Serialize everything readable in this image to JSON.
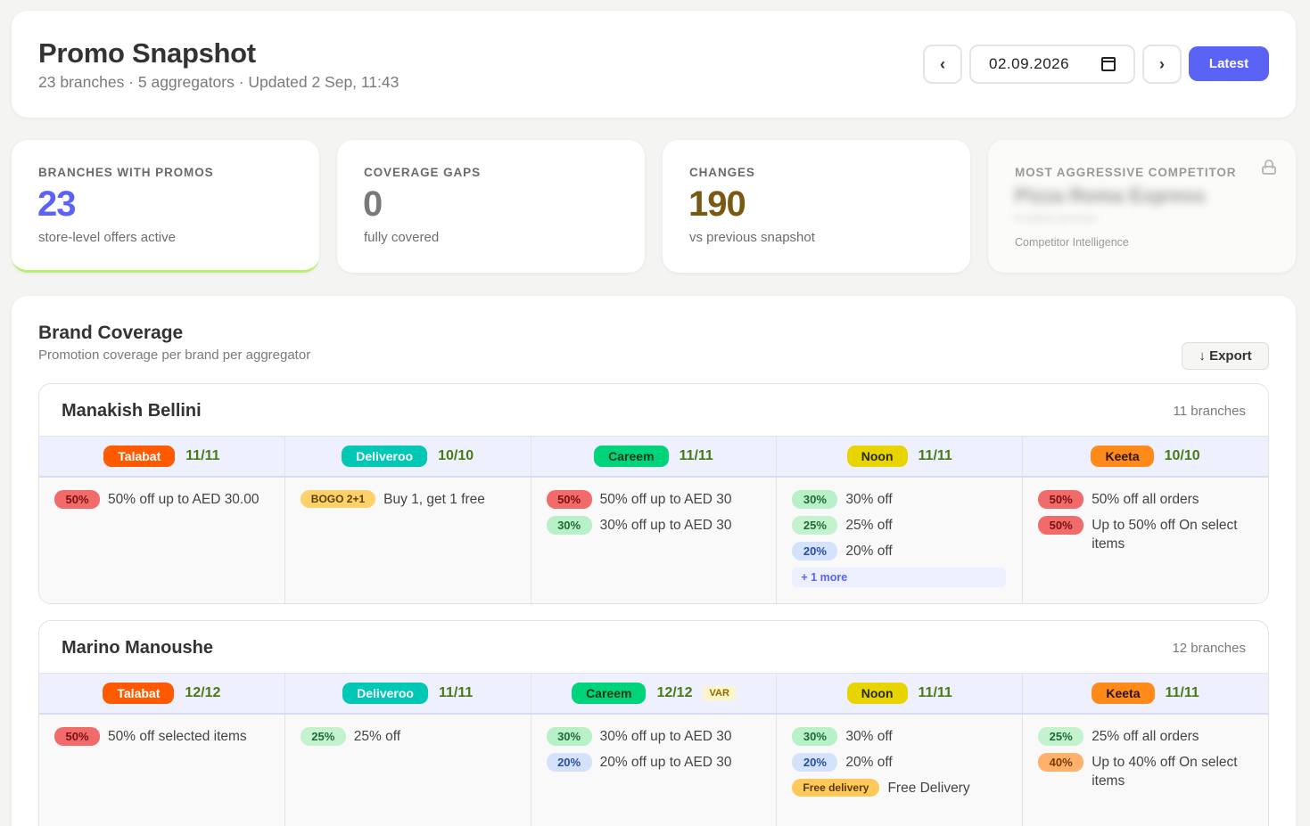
{
  "header": {
    "title": "Promo Snapshot",
    "subtitle": "23 branches · 5 aggregators · Updated 2 Sep, 11:43",
    "prev_label": "‹",
    "next_label": "›",
    "date": "02.09.2026",
    "latest_label": "Latest"
  },
  "stats": [
    {
      "label": "BRANCHES WITH PROMOS",
      "value": "23",
      "desc": "store-level offers active",
      "color": "#5b63f6"
    },
    {
      "label": "COVERAGE GAPS",
      "value": "0",
      "desc": "fully covered",
      "color": "#7a7a7a"
    },
    {
      "label": "CHANGES",
      "value": "190",
      "desc": "vs previous snapshot",
      "color": "#7a5a12"
    },
    {
      "label": "MOST AGGRESSIVE COMPETITOR",
      "blurred_name": "Pizza Roma Express",
      "blurred_sub": "9 active promos",
      "desc": "Competitor Intelligence"
    }
  ],
  "coverage": {
    "title": "Brand Coverage",
    "subtitle": "Promotion coverage per brand per aggregator",
    "export_label": "↓ Export",
    "colors": {
      "Talabat": "#ff5a00",
      "Deliveroo": "#00c8b4",
      "Careem": "#00d47a",
      "Noon": "#e8d400",
      "Keeta": "#ff8a1a"
    },
    "brands": [
      {
        "name": "Manakish Bellini",
        "branches": "11 branches",
        "aggregators": [
          {
            "name": "Talabat",
            "ratio": "11/11",
            "promos": [
              {
                "badge": "50%",
                "text": "50% off up to AED 30.00"
              }
            ]
          },
          {
            "name": "Deliveroo",
            "ratio": "10/10",
            "promos": [
              {
                "badge": "BOGO 2+1",
                "text": "Buy 1, get 1 free"
              }
            ]
          },
          {
            "name": "Careem",
            "ratio": "11/11",
            "promos": [
              {
                "badge": "50%",
                "text": "50% off up to AED 30"
              },
              {
                "badge": "30%",
                "text": "30% off up to AED 30"
              }
            ]
          },
          {
            "name": "Noon",
            "ratio": "11/11",
            "promos": [
              {
                "badge": "30%",
                "text": "30% off"
              },
              {
                "badge": "25%",
                "text": "25% off"
              },
              {
                "badge": "20%",
                "text": "20% off"
              }
            ],
            "more": "+ 1 more"
          },
          {
            "name": "Keeta",
            "ratio": "10/10",
            "promos": [
              {
                "badge": "50%",
                "text": "50% off all orders"
              },
              {
                "badge": "50%",
                "text": "Up to 50% off On select items"
              }
            ]
          }
        ]
      },
      {
        "name": "Marino Manoushe",
        "branches": "12 branches",
        "aggregators": [
          {
            "name": "Talabat",
            "ratio": "12/12",
            "promos": [
              {
                "badge": "50%",
                "text": "50% off selected items"
              }
            ]
          },
          {
            "name": "Deliveroo",
            "ratio": "11/11",
            "promos": [
              {
                "badge": "25%",
                "text": "25% off"
              }
            ]
          },
          {
            "name": "Careem",
            "ratio": "12/12",
            "tag": "VAR",
            "promos": [
              {
                "badge": "30%",
                "text": "30% off up to AED 30"
              },
              {
                "badge": "20%",
                "text": "20% off up to AED 30"
              }
            ]
          },
          {
            "name": "Noon",
            "ratio": "11/11",
            "promos": [
              {
                "badge": "30%",
                "text": "30% off"
              },
              {
                "badge": "20%",
                "text": "20% off"
              },
              {
                "badge": "Free delivery",
                "text": "Free Delivery"
              }
            ]
          },
          {
            "name": "Keeta",
            "ratio": "11/11",
            "promos": [
              {
                "badge": "25%",
                "text": "25% off all orders"
              },
              {
                "badge": "40%",
                "text": "Up to 40% off On select items"
              }
            ]
          }
        ]
      }
    ]
  }
}
